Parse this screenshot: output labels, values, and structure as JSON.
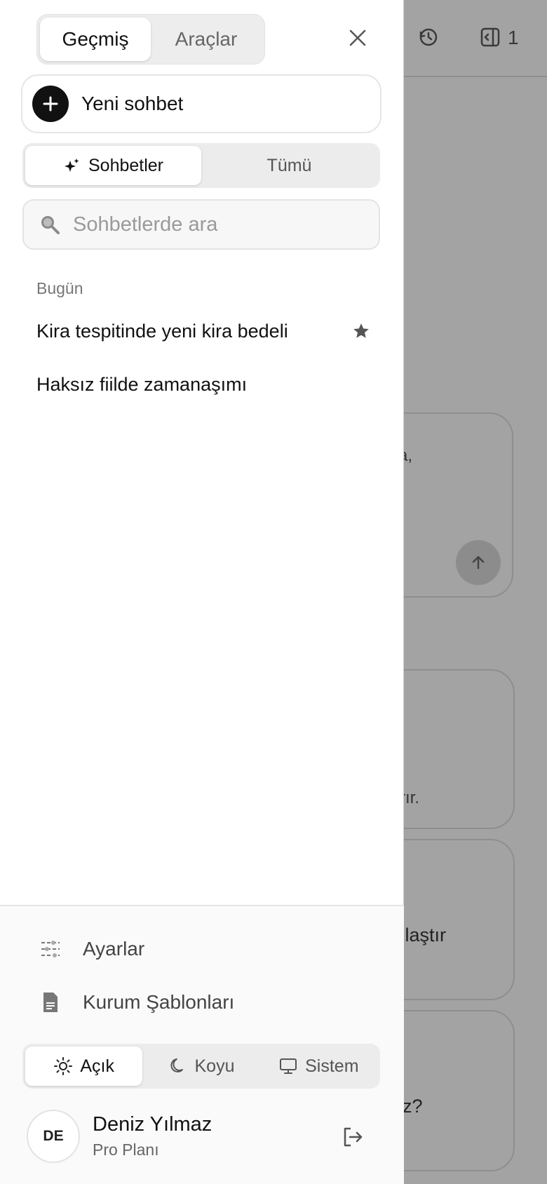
{
  "drawer": {
    "top_tabs": [
      "Geçmiş",
      "Araçlar"
    ],
    "new_chat_label": "Yeni sohbet",
    "seg_tabs": [
      "Sohbetler",
      "Tümü"
    ],
    "search_placeholder": "Sohbetlerde ara",
    "section_label": "Bugün",
    "chats": [
      {
        "title": "Kira tespitinde yeni kira bedeli",
        "starred": true
      },
      {
        "title": "Haksız fiilde zamanaşımı",
        "starred": false
      }
    ],
    "menu": {
      "settings": "Ayarlar",
      "templates": "Kurum Şablonları"
    },
    "theme": [
      "Açık",
      "Koyu",
      "Sistem"
    ],
    "user": {
      "initials": "DE",
      "name": "Deniz Yılmaz",
      "plan": "Pro Planı"
    }
  },
  "background": {
    "top_count": "1",
    "fragments": [
      "a,",
      "rır.",
      "ılaştır",
      "z?"
    ]
  }
}
